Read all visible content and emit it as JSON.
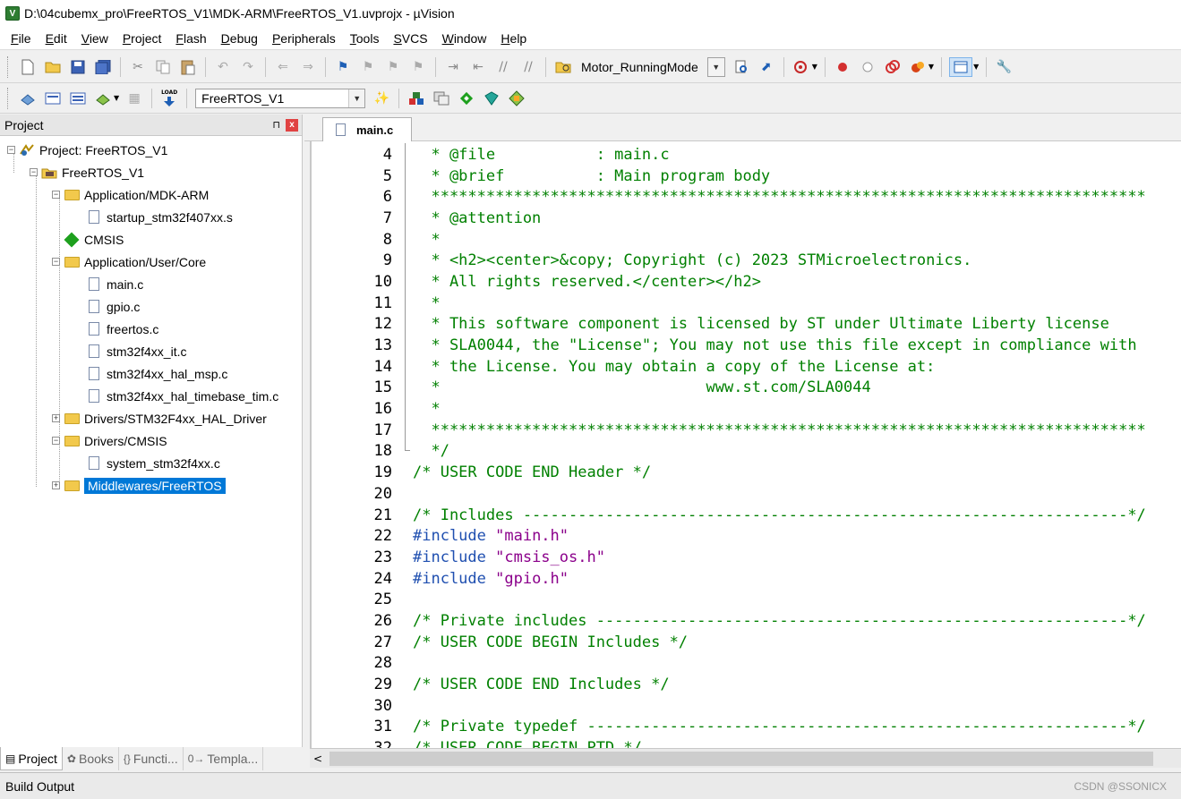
{
  "window": {
    "app_icon": "V",
    "title": "D:\\04cubemx_pro\\FreeRTOS_V1\\MDK-ARM\\FreeRTOS_V1.uvprojx - µVision"
  },
  "menu": [
    "File",
    "Edit",
    "View",
    "Project",
    "Flash",
    "Debug",
    "Peripherals",
    "Tools",
    "SVCS",
    "Window",
    "Help"
  ],
  "toolbar1": {
    "target_combo": "Motor_RunningMode"
  },
  "toolbar2": {
    "target_combo": "FreeRTOS_V1",
    "load_label": "LOAD"
  },
  "project_panel": {
    "title": "Project",
    "pin": "⊓",
    "close": "x",
    "tree": [
      {
        "label": "Project: FreeRTOS_V1",
        "level": 0,
        "expander": "−",
        "type": "project"
      },
      {
        "label": "FreeRTOS_V1",
        "level": 1,
        "expander": "−",
        "type": "target"
      },
      {
        "label": "Application/MDK-ARM",
        "level": 2,
        "expander": "−",
        "type": "folder"
      },
      {
        "label": "startup_stm32f407xx.s",
        "level": 3,
        "expander": "",
        "type": "file"
      },
      {
        "label": "CMSIS",
        "level": 2,
        "expander": "",
        "type": "cmsis"
      },
      {
        "label": "Application/User/Core",
        "level": 2,
        "expander": "−",
        "type": "folder"
      },
      {
        "label": "main.c",
        "level": 3,
        "expander": "",
        "type": "file"
      },
      {
        "label": "gpio.c",
        "level": 3,
        "expander": "",
        "type": "file"
      },
      {
        "label": "freertos.c",
        "level": 3,
        "expander": "",
        "type": "file"
      },
      {
        "label": "stm32f4xx_it.c",
        "level": 3,
        "expander": "",
        "type": "file"
      },
      {
        "label": "stm32f4xx_hal_msp.c",
        "level": 3,
        "expander": "",
        "type": "file"
      },
      {
        "label": "stm32f4xx_hal_timebase_tim.c",
        "level": 3,
        "expander": "",
        "type": "file"
      },
      {
        "label": "Drivers/STM32F4xx_HAL_Driver",
        "level": 2,
        "expander": "+",
        "type": "folder"
      },
      {
        "label": "Drivers/CMSIS",
        "level": 2,
        "expander": "−",
        "type": "folder"
      },
      {
        "label": "system_stm32f4xx.c",
        "level": 3,
        "expander": "",
        "type": "file"
      },
      {
        "label": "Middlewares/FreeRTOS",
        "level": 2,
        "expander": "+",
        "type": "folder",
        "selected": true
      }
    ],
    "tabs": [
      {
        "label": "Project",
        "icon": "▤",
        "active": true
      },
      {
        "label": "Books",
        "icon": "✿",
        "active": false
      },
      {
        "label": "Functi...",
        "icon": "{}",
        "active": false
      },
      {
        "label": "Templa...",
        "icon": "0→",
        "active": false
      }
    ]
  },
  "editor": {
    "tab": "main.c",
    "lines": [
      {
        "n": "4",
        "parts": [
          {
            "t": "  * @file           : main.c",
            "c": "cm"
          }
        ]
      },
      {
        "n": "5",
        "parts": [
          {
            "t": "  * @brief          : Main program body",
            "c": "cm"
          }
        ]
      },
      {
        "n": "6",
        "parts": [
          {
            "t": "  ******************************************************************************",
            "c": "cm"
          }
        ]
      },
      {
        "n": "7",
        "parts": [
          {
            "t": "  * @attention",
            "c": "cm"
          }
        ]
      },
      {
        "n": "8",
        "parts": [
          {
            "t": "  *",
            "c": "cm"
          }
        ]
      },
      {
        "n": "9",
        "parts": [
          {
            "t": "  * <h2><center>&copy; Copyright (c) 2023 STMicroelectronics.",
            "c": "cm"
          }
        ]
      },
      {
        "n": "10",
        "parts": [
          {
            "t": "  * All rights reserved.</center></h2>",
            "c": "cm"
          }
        ]
      },
      {
        "n": "11",
        "parts": [
          {
            "t": "  *",
            "c": "cm"
          }
        ]
      },
      {
        "n": "12",
        "parts": [
          {
            "t": "  * This software component is licensed by ST under Ultimate Liberty license",
            "c": "cm"
          }
        ]
      },
      {
        "n": "13",
        "parts": [
          {
            "t": "  * SLA0044, the \"License\"; You may not use this file except in compliance with",
            "c": "cm"
          }
        ]
      },
      {
        "n": "14",
        "parts": [
          {
            "t": "  * the License. You may obtain a copy of the License at:",
            "c": "cm"
          }
        ]
      },
      {
        "n": "15",
        "parts": [
          {
            "t": "  *                             www.st.com/SLA0044",
            "c": "cm"
          }
        ]
      },
      {
        "n": "16",
        "parts": [
          {
            "t": "  *",
            "c": "cm"
          }
        ]
      },
      {
        "n": "17",
        "parts": [
          {
            "t": "  ******************************************************************************",
            "c": "cm"
          }
        ]
      },
      {
        "n": "18",
        "parts": [
          {
            "t": "  */",
            "c": "cm"
          }
        ]
      },
      {
        "n": "19",
        "parts": [
          {
            "t": "/* USER CODE END Header */",
            "c": "cm"
          }
        ]
      },
      {
        "n": "20",
        "parts": []
      },
      {
        "n": "21",
        "parts": [
          {
            "t": "/* Includes ------------------------------------------------------------------*/",
            "c": "cm"
          }
        ]
      },
      {
        "n": "22",
        "parts": [
          {
            "t": "#include ",
            "c": "pp"
          },
          {
            "t": "\"main.h\"",
            "c": "str"
          }
        ]
      },
      {
        "n": "23",
        "parts": [
          {
            "t": "#include ",
            "c": "pp"
          },
          {
            "t": "\"cmsis_os.h\"",
            "c": "str"
          }
        ]
      },
      {
        "n": "24",
        "parts": [
          {
            "t": "#include ",
            "c": "pp"
          },
          {
            "t": "\"gpio.h\"",
            "c": "str"
          }
        ]
      },
      {
        "n": "25",
        "parts": []
      },
      {
        "n": "26",
        "parts": [
          {
            "t": "/* Private includes ----------------------------------------------------------*/",
            "c": "cm"
          }
        ]
      },
      {
        "n": "27",
        "parts": [
          {
            "t": "/* USER CODE BEGIN Includes */",
            "c": "cm"
          }
        ]
      },
      {
        "n": "28",
        "parts": []
      },
      {
        "n": "29",
        "parts": [
          {
            "t": "/* USER CODE END Includes */",
            "c": "cm"
          }
        ]
      },
      {
        "n": "30",
        "parts": []
      },
      {
        "n": "31",
        "parts": [
          {
            "t": "/* Private typedef -----------------------------------------------------------*/",
            "c": "cm"
          }
        ]
      },
      {
        "n": "32",
        "parts": [
          {
            "t": "/* USER CODE BEGIN PTD */",
            "c": "cm"
          }
        ]
      }
    ]
  },
  "build_output": {
    "label": "Build Output"
  },
  "watermark": "CSDN @SSONICX"
}
